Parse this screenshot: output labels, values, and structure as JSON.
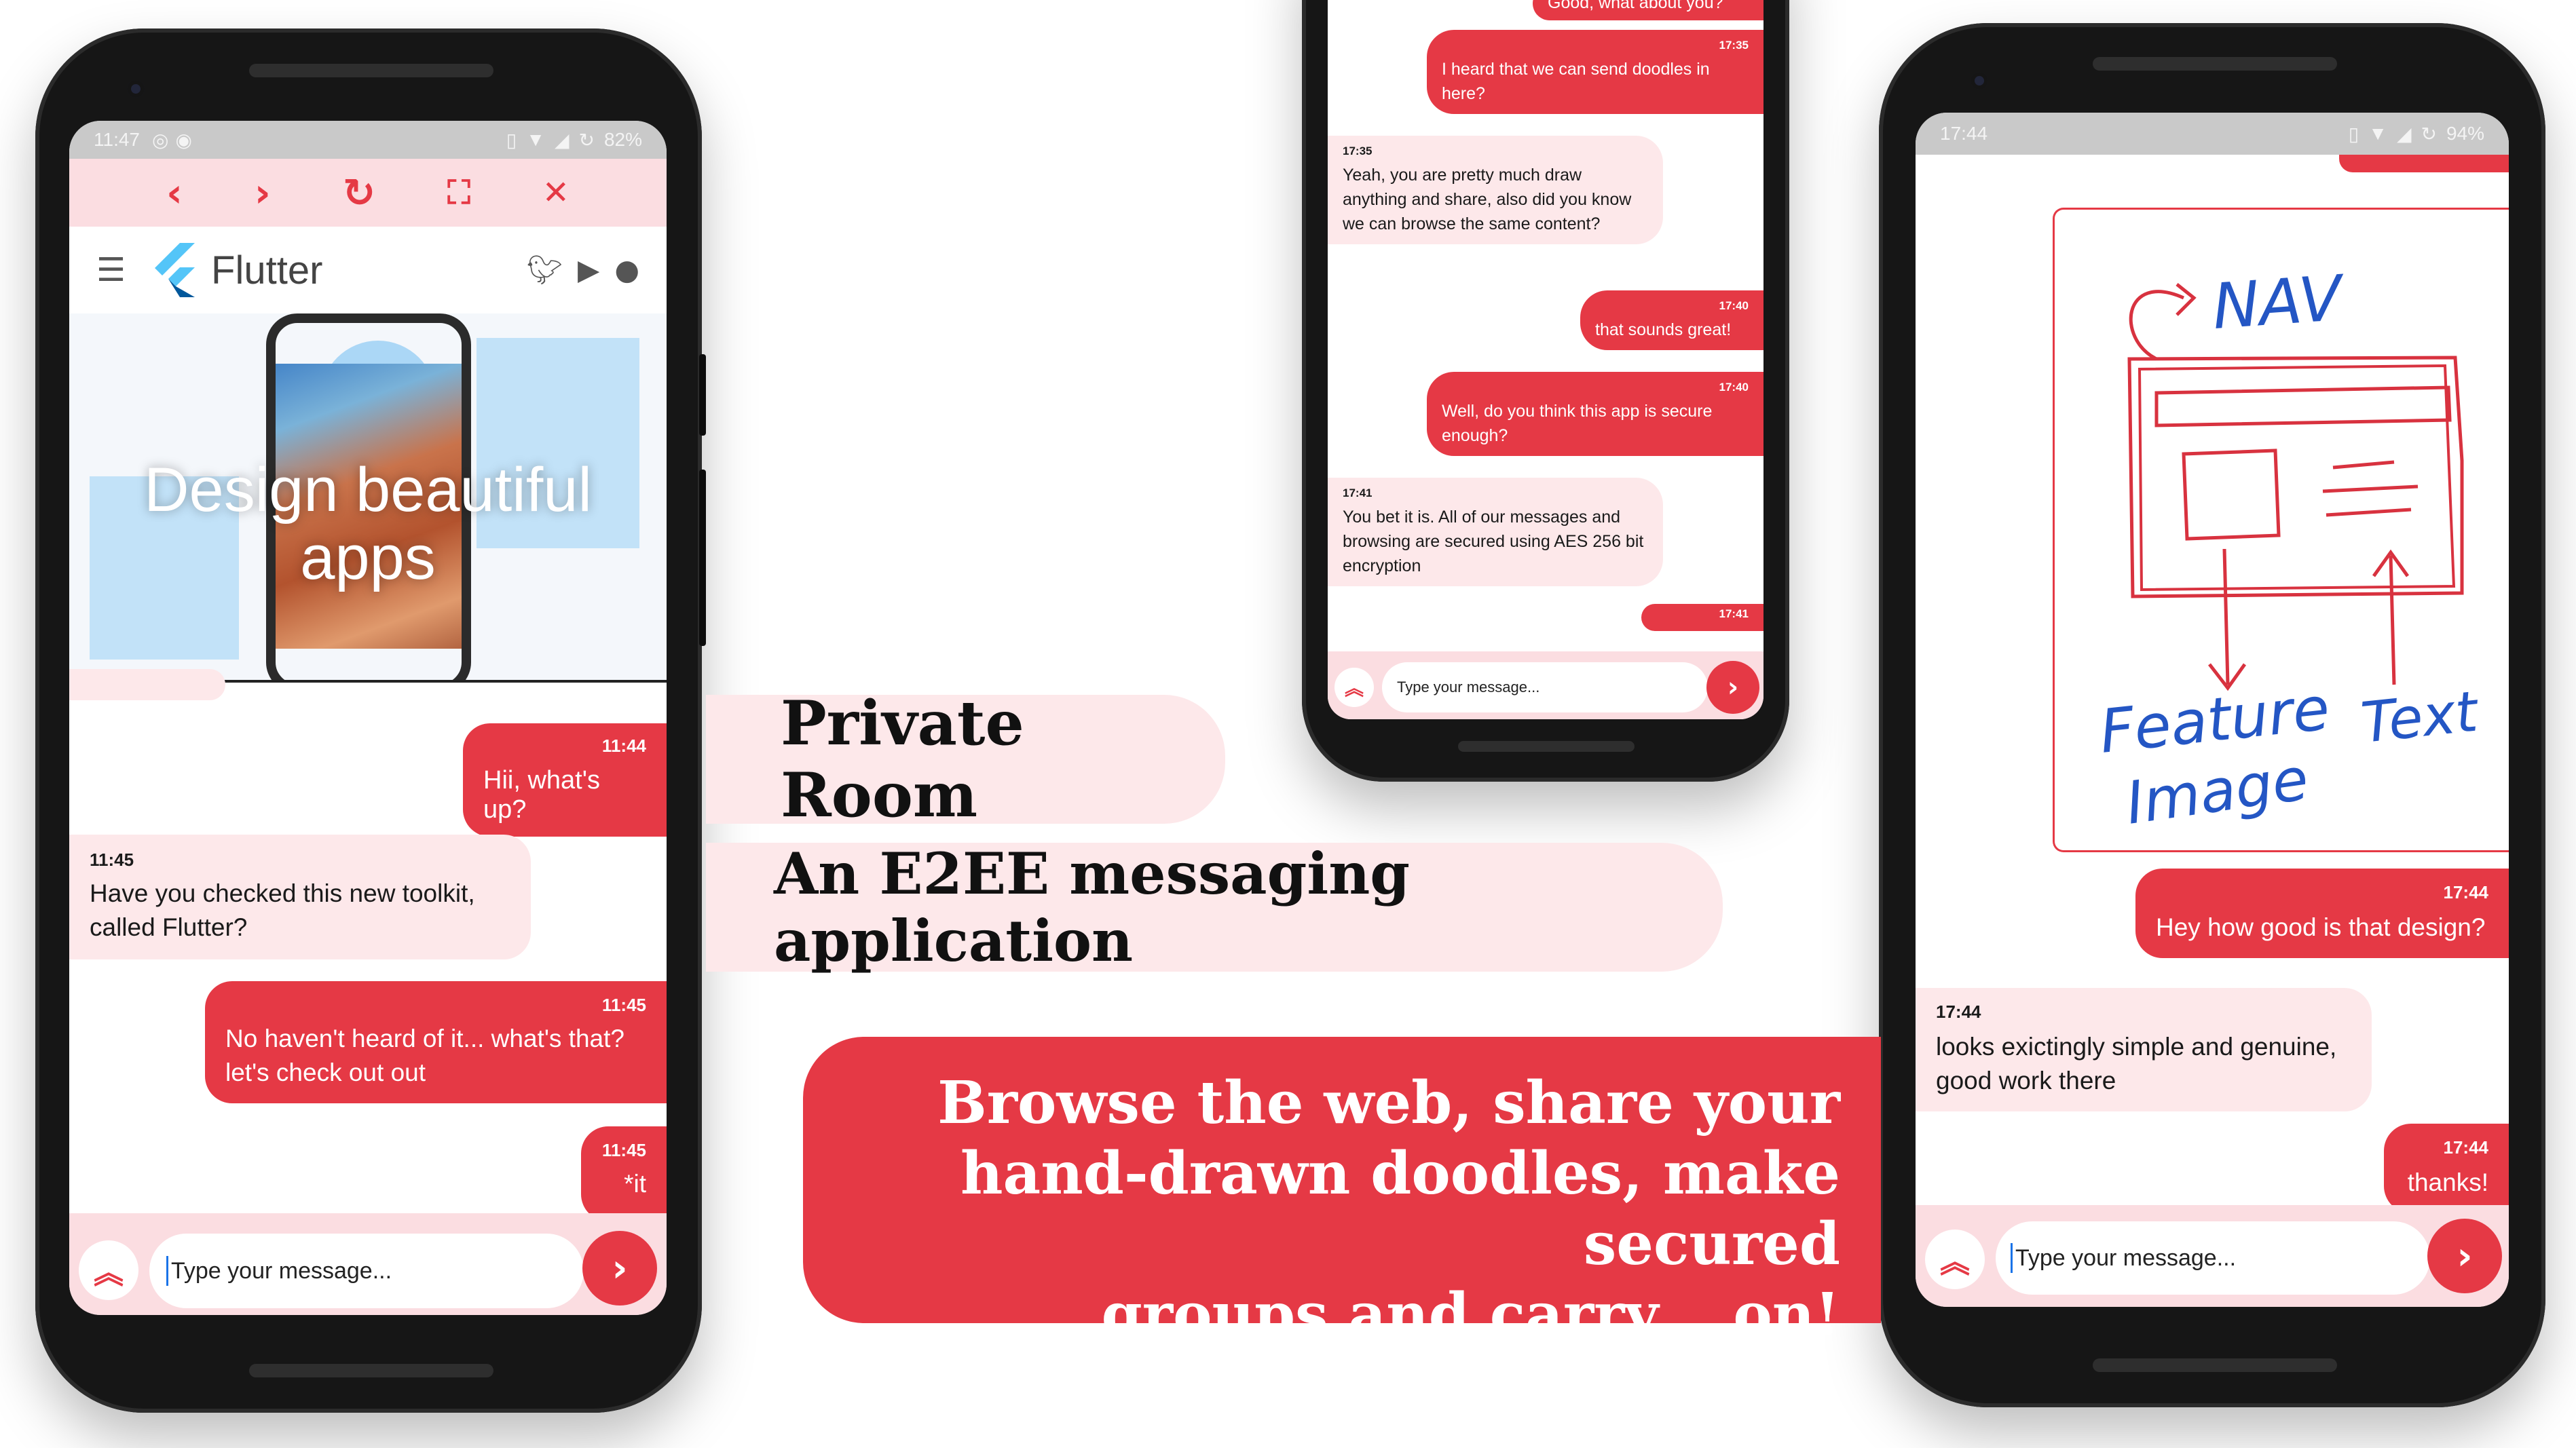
{
  "colors": {
    "accent": "#e53945",
    "bubble_in": "#fde8ea",
    "toolbar": "#fbdde1"
  },
  "tagline": {
    "title": "Private Room",
    "subtitle": "An E2EE messaging application",
    "banner_lines": [
      "Browse the web, share your",
      "hand-drawn doodles, make secured",
      "groups and carry... on!"
    ]
  },
  "phone_left": {
    "status": {
      "time": "11:47",
      "battery": "82%",
      "icons_left": [
        "whatsapp-icon",
        "signal-icon"
      ],
      "icons_right": [
        "vibrate-icon",
        "wifi-icon",
        "cellular-icon",
        "sync-icon"
      ]
    },
    "browser_toolbar": {
      "icons": [
        "back-icon",
        "forward-icon",
        "reload-icon",
        "fullscreen-icon",
        "close-icon"
      ]
    },
    "site": {
      "logo_text": "Flutter",
      "social_icons": [
        "twitter-icon",
        "youtube-icon",
        "github-icon"
      ],
      "hero_text": [
        "Design beautiful",
        "apps"
      ]
    },
    "messages": [
      {
        "dir": "out",
        "time": "11:44",
        "text": "Hii, what's up?"
      },
      {
        "dir": "in",
        "time": "11:45",
        "text": "Have you checked this new toolkit, called Flutter?"
      },
      {
        "dir": "out",
        "time": "11:45",
        "text": "No haven't heard of it... what's that? let's check out out"
      },
      {
        "dir": "out",
        "time": "11:45",
        "text": "*it"
      }
    ],
    "composer": {
      "placeholder": "Type your message..."
    }
  },
  "phone_middle": {
    "messages": [
      {
        "dir": "out",
        "time": "",
        "text": "Good, what about you?"
      },
      {
        "dir": "out",
        "time": "17:35",
        "text": "I heard that we can send doodles in here?"
      },
      {
        "dir": "in",
        "time": "17:35",
        "text": "Yeah, you are pretty much draw anything and share, also did you know we can browse the same content?"
      },
      {
        "dir": "out",
        "time": "17:40",
        "text": "that sounds great!"
      },
      {
        "dir": "out",
        "time": "17:40",
        "text": "Well, do you think this app is secure enough?"
      },
      {
        "dir": "in",
        "time": "17:41",
        "text": "You bet it is. All of our messages and browsing are secured using AES 256 bit encryption"
      },
      {
        "dir": "out",
        "time": "17:41",
        "text": ""
      }
    ],
    "composer": {
      "placeholder": "Type your message..."
    }
  },
  "phone_right": {
    "status": {
      "time": "17:44",
      "battery": "94%"
    },
    "doodle_labels": {
      "nav": "NAV",
      "feature": "Feature",
      "image": "Image",
      "text": "Text"
    },
    "messages": [
      {
        "dir": "out",
        "time": "17:44",
        "text": "Hey how good is that design?"
      },
      {
        "dir": "in",
        "time": "17:44",
        "text": "looks exictingly simple and genuine, good work there"
      },
      {
        "dir": "out",
        "time": "17:44",
        "text": "thanks!"
      }
    ],
    "composer": {
      "placeholder": "Type your message..."
    }
  }
}
